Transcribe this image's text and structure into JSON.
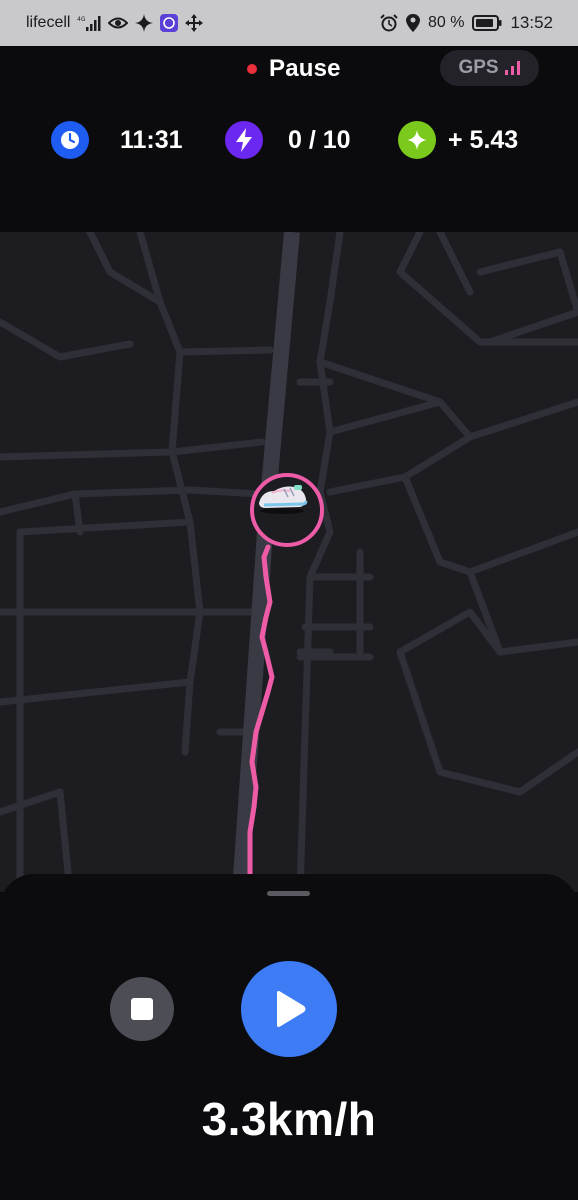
{
  "status_bar": {
    "carrier": "lifecell",
    "battery_percent": "80 %",
    "time": "13:52",
    "icons": [
      "signal-icon",
      "eye-icon",
      "sparkle-icon",
      "app-badge-icon",
      "move-icon",
      "alarm-icon",
      "location-icon",
      "battery-icon"
    ]
  },
  "header": {
    "status_label": "Pause",
    "status_color": "#e8313b",
    "gps_label": "GPS",
    "gps_icon": "signal-bars-icon"
  },
  "stats": {
    "time": {
      "value": "11:31",
      "icon": "clock-icon",
      "color": "#1f5cf2"
    },
    "energy": {
      "value": "0 / 10",
      "icon": "lightning-icon",
      "color": "#6b28f0"
    },
    "earnings": {
      "value": "+ 5.43",
      "icon": "sparkle-icon",
      "color": "#7bc91c"
    }
  },
  "map": {
    "route_color": "#ee5ca8",
    "marker_icon": "sneaker-icon"
  },
  "controls": {
    "stop_icon": "stop-icon",
    "play_icon": "play-icon",
    "accent": "#3d7cf5"
  },
  "speed": "3.3km/h"
}
